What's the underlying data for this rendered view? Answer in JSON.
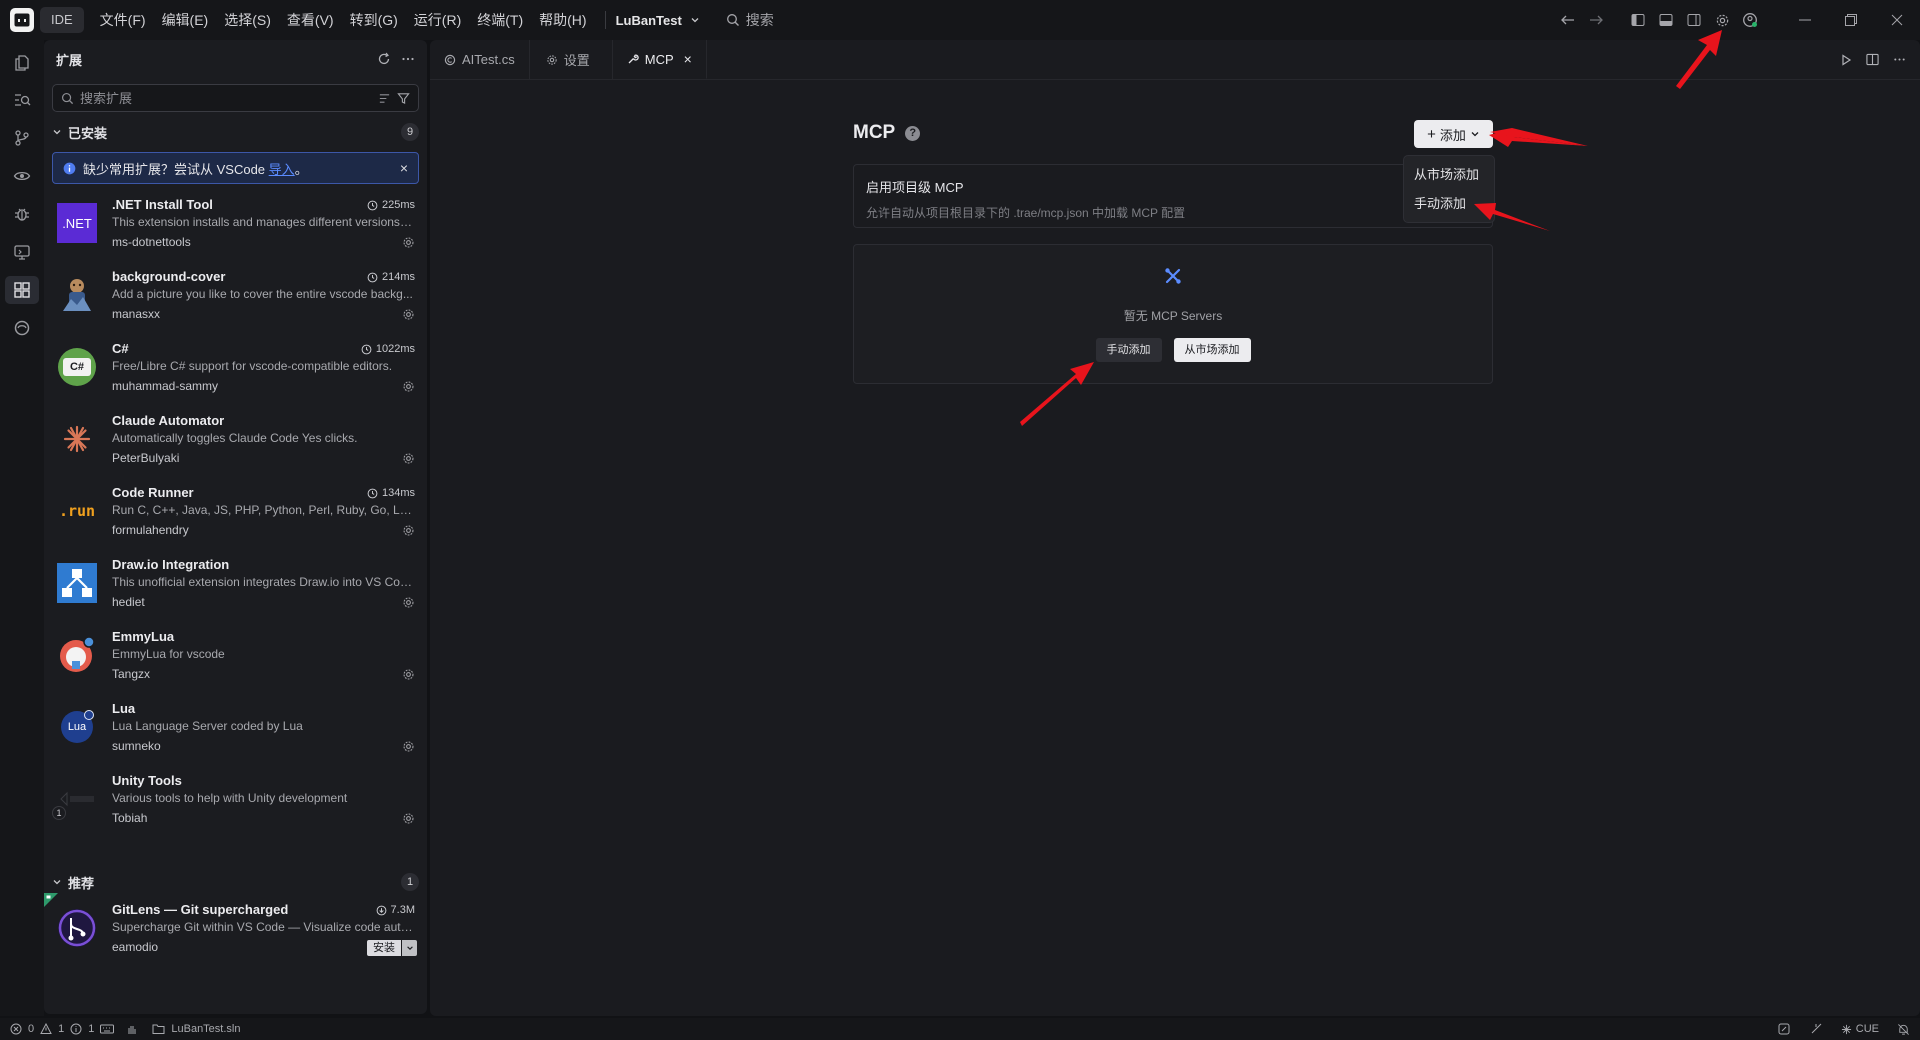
{
  "titlebar": {
    "ide_label": "IDE",
    "menu": [
      "文件(F)",
      "编辑(E)",
      "选择(S)",
      "查看(V)",
      "转到(G)",
      "运行(R)",
      "终端(T)",
      "帮助(H)"
    ],
    "project": "LuBanTest",
    "search": "搜索"
  },
  "sidebar": {
    "title": "扩展",
    "search_placeholder": "搜索扩展",
    "installed": {
      "label": "已安装",
      "count": "9",
      "notice_text": "缺少常用扩展？尝试从 VSCode",
      "notice_link": "导入",
      "notice_end": "。",
      "notice_close": "×"
    },
    "extensions": [
      {
        "name": ".NET Install Tool",
        "desc": "This extension installs and manages different versions o...",
        "publisher": "ms-dotnettools",
        "time": "225ms",
        "icon": "dotnet-icon",
        "icon_text": ".NET"
      },
      {
        "name": "background-cover",
        "desc": "Add a picture you like to cover the entire vscode backg...",
        "publisher": "manasxx",
        "time": "214ms",
        "icon": "background-cover-icon"
      },
      {
        "name": "C#",
        "desc": "Free/Libre C# support for vscode-compatible editors.",
        "publisher": "muhammad-sammy",
        "time": "1022ms",
        "icon": "csharp-icon",
        "icon_text": "C#"
      },
      {
        "name": "Claude Automator",
        "desc": "Automatically toggles Claude Code Yes clicks.",
        "publisher": "PeterBulyaki",
        "time": "",
        "icon": "claude-icon"
      },
      {
        "name": "Code Runner",
        "desc": "Run C, C++, Java, JS, PHP, Python, Perl, Ruby, Go, Lua, ...",
        "publisher": "formulahendry",
        "time": "134ms",
        "icon": "code-runner-icon",
        "icon_text": ".run"
      },
      {
        "name": "Draw.io Integration",
        "desc": "This unofficial extension integrates Draw.io into VS Code.",
        "publisher": "hediet",
        "time": "",
        "icon": "drawio-icon"
      },
      {
        "name": "EmmyLua",
        "desc": "EmmyLua for vscode",
        "publisher": "Tangzx",
        "time": "",
        "icon": "emmylua-icon"
      },
      {
        "name": "Lua",
        "desc": "Lua Language Server coded by Lua",
        "publisher": "sumneko",
        "time": "",
        "icon": "lua-icon",
        "icon_text": "Lua"
      },
      {
        "name": "Unity Tools",
        "desc": "Various tools to help with Unity development",
        "publisher": "Tobiah",
        "time": "",
        "icon": "unity-icon",
        "badge": "1"
      }
    ],
    "recommended": {
      "label": "推荐",
      "count": "1",
      "item": {
        "name": "GitLens — Git supercharged",
        "desc": "Supercharge Git within VS Code — Visualize code auth...",
        "publisher": "eamodio",
        "downloads": "7.3M",
        "install": "安装",
        "icon": "gitlens-icon"
      }
    }
  },
  "tabs": [
    {
      "label": "AITest.cs",
      "icon": "csharp-file-icon"
    },
    {
      "label": "设置",
      "icon": "gear-icon"
    },
    {
      "label": "MCP",
      "icon": "wrench-icon",
      "close": "×"
    }
  ],
  "mcp": {
    "title": "MCP",
    "help": "?",
    "add_button": "添加",
    "add_plus": "+",
    "dropdown": [
      "从市场添加",
      "手动添加"
    ],
    "project_card": {
      "title": "启用项目级 MCP",
      "subtitle": "允许自动从项目根目录下的 .trae/mcp.json 中加载 MCP 配置"
    },
    "empty_card": {
      "text": "暂无 MCP Servers",
      "manual_button": "手动添加",
      "market_button": "从市场添加"
    }
  },
  "statusbar": {
    "errors": "0",
    "warnings": "1",
    "info": "1",
    "solution": "LuBanTest.sln",
    "right_label": "CUE"
  },
  "colors": {
    "accent": "#5b8cff",
    "annotation_arrow": "#e8141c",
    "notice_bg": "#1d2947"
  }
}
